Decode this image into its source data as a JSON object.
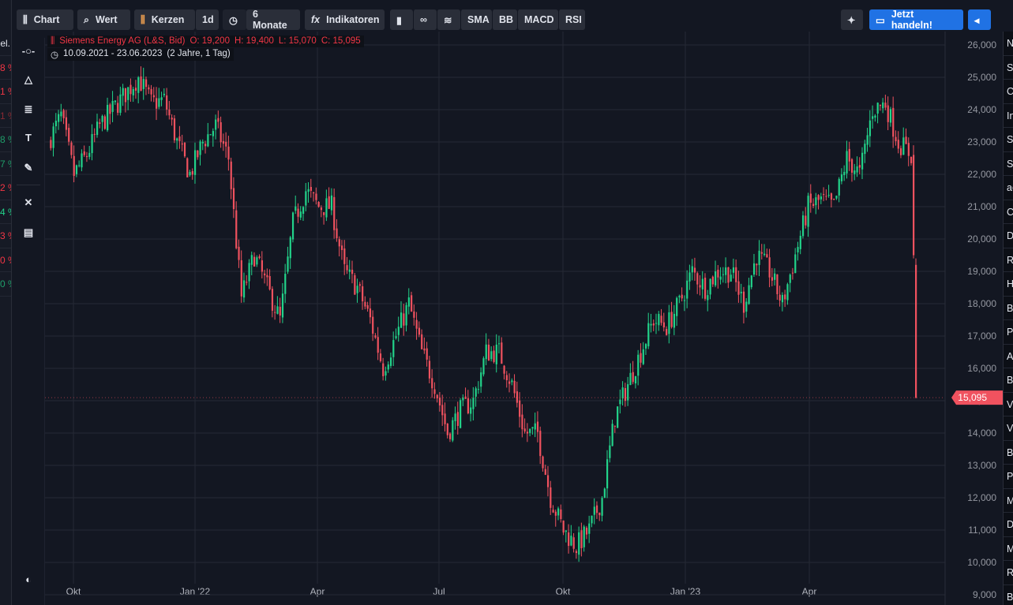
{
  "toolbar": {
    "chart": "Chart",
    "wert": "Wert",
    "kerzen": "Kerzen",
    "interval": "1d",
    "range": "6 Monate",
    "indikatoren": "Indikatoren",
    "sma": "SMA",
    "bb": "BB",
    "macd": "MACD",
    "rsi": "RSI",
    "trade": "Jetzt handeln!"
  },
  "legend": {
    "name": "Siemens Energy AG (L&S, Bid)",
    "o": "O: 19,200",
    "h": "H: 19,400",
    "l": "L: 15,070",
    "c": "C: 15,095",
    "dates": "10.09.2021 - 23.06.2023",
    "span": "(2 Jahre, 1 Tag)"
  },
  "left_list": [
    "el.",
    "8 %",
    "1 %",
    "1 %",
    "8 %",
    "7 %",
    "2 %",
    "4 %",
    "3 %",
    "0 %",
    "0 %"
  ],
  "right_list": [
    "N",
    "S",
    "C",
    "In",
    "S",
    "S",
    "ac",
    "C",
    "D",
    "R",
    "H",
    "B",
    "P",
    "A",
    "B",
    "V",
    "V",
    "B",
    "P",
    "M",
    "D",
    "M",
    "R",
    "B"
  ],
  "colors": {
    "up": "#22d38a",
    "down": "#f0525f",
    "accent": "#2072e4",
    "bg": "#131722"
  },
  "chart_data": {
    "type": "candlestick",
    "title": "Siemens Energy AG (L&S, Bid)",
    "ylim": [
      9000,
      26000
    ],
    "yticks": [
      "26,000",
      "25,000",
      "24,000",
      "23,000",
      "22,000",
      "21,000",
      "20,000",
      "19,000",
      "18,000",
      "17,000",
      "16,000",
      "15,000",
      "14,000",
      "13,000",
      "12,000",
      "11,000",
      "10,000",
      "9,000"
    ],
    "xticks": [
      "Okt",
      "Jan '22",
      "Apr",
      "Jul",
      "Okt",
      "Jan '23",
      "Apr"
    ],
    "last_price": "15,095",
    "last_candle": {
      "open": 19200,
      "high": 19400,
      "low": 15070,
      "close": 15095
    },
    "weekly_closes": [
      23000,
      23800,
      22000,
      22600,
      23500,
      24000,
      24500,
      25000,
      24200,
      24300,
      23000,
      22000,
      23000,
      23500,
      22500,
      18200,
      19500,
      18500,
      17500,
      20500,
      21500,
      21000,
      21000,
      19000,
      18500,
      17500,
      16000,
      17000,
      18000,
      16500,
      15500,
      14000,
      14700,
      15000,
      16500,
      16500,
      15500,
      14000,
      14000,
      12000,
      11000,
      10500,
      11000,
      12000,
      14500,
      15500,
      16500,
      17500,
      17300,
      18000,
      19000,
      18500,
      19000,
      19000,
      18000,
      19500,
      19000,
      18000,
      19500,
      21000,
      21200,
      21000,
      22500,
      22000,
      24000,
      24200,
      23000,
      22600
    ]
  }
}
